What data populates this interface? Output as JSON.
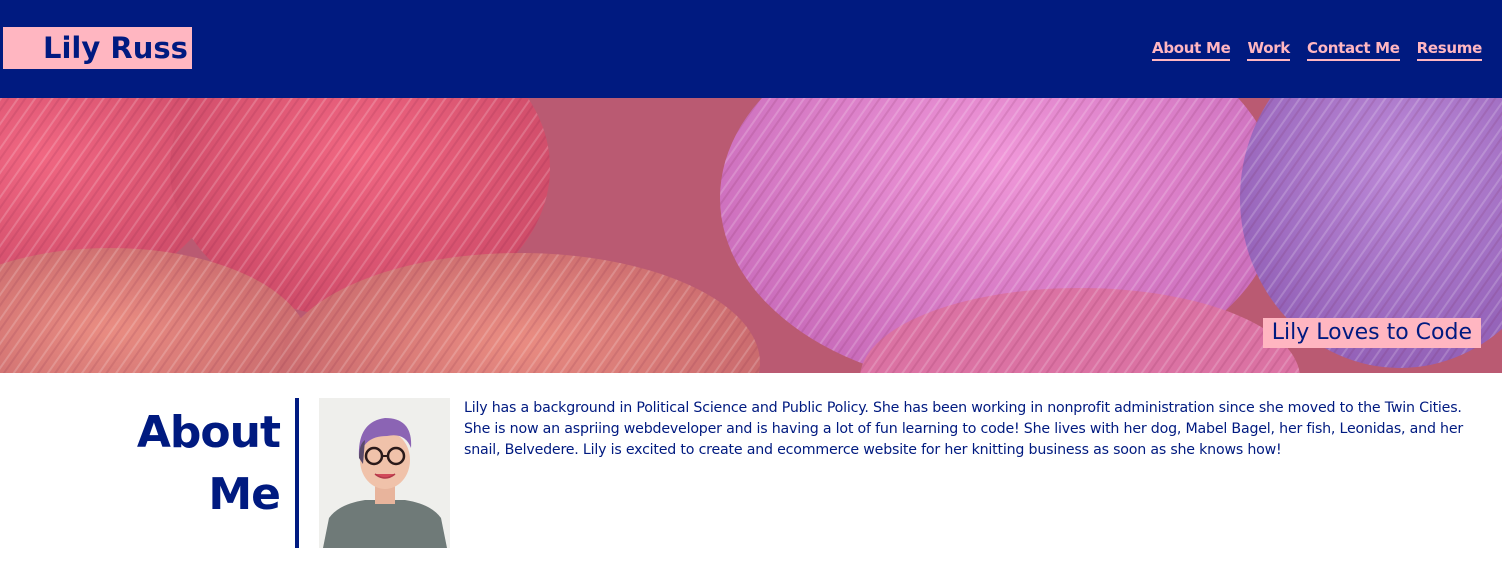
{
  "site": {
    "title": "Lily Russ",
    "colors": {
      "navy": "#001a80",
      "pink": "#ffb6c1"
    }
  },
  "nav": {
    "items": [
      {
        "label": "About Me"
      },
      {
        "label": "Work"
      },
      {
        "label": "Contact Me"
      },
      {
        "label": "Resume"
      }
    ]
  },
  "hero": {
    "image": "pink-and-purple-yarn-balls",
    "tagline": "Lily Loves to Code"
  },
  "about": {
    "heading_line1": "About",
    "heading_line2": "Me",
    "portrait": "portrait-photo-lily",
    "bio": "Lily has a background in Political Science and Public Policy. She has been working in nonprofit administration since she moved to the Twin Cities. She is now an aspriing webdeveloper and is having a lot of fun learning to code! She lives with her dog, Mabel Bagel, her fish, Leonidas, and her snail, Belvedere. Lily is excited to create and ecommerce website for her knitting business as soon as she knows how!"
  }
}
